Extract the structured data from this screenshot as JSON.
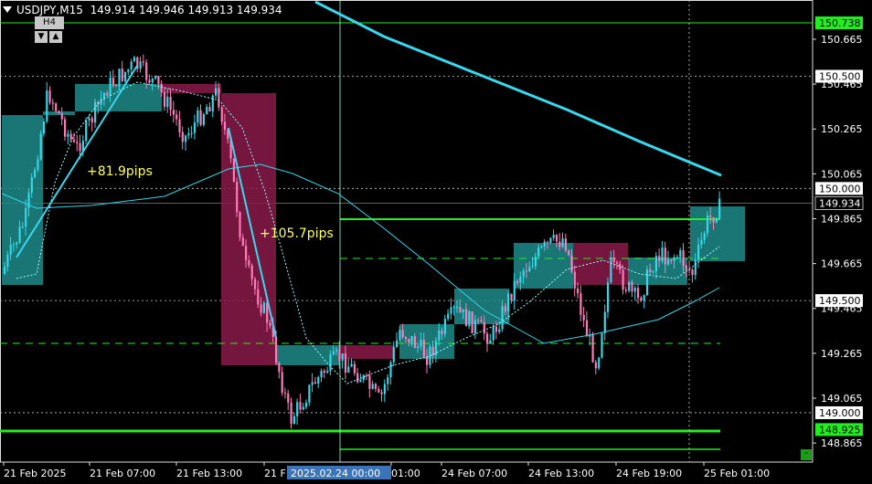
{
  "header": {
    "symbol": "USDJPY,M15",
    "open": "149.914",
    "high": "149.946",
    "low": "149.913",
    "close": "149.934"
  },
  "timeframe_box": {
    "label": "H4",
    "down_icon": "▼",
    "up_icon": "▲"
  },
  "corner_button": "-",
  "colors": {
    "background": "#000000",
    "grid": "#c0c0c0",
    "bull": "#35d6e6",
    "bear": "#ff7ab8",
    "bull_zone": "#1f8a8a",
    "bear_zone": "#8a1a4a",
    "level_green": "#22ee22",
    "ma_slow": "#38d8ee",
    "annotation": "#ffff66"
  },
  "price_axis": {
    "min": 148.78,
    "max": 150.84,
    "ticks": [
      "150.665",
      "150.465",
      "150.265",
      "150.065",
      "149.865",
      "149.665",
      "149.465",
      "149.265",
      "149.065",
      "148.865"
    ],
    "tick_values": [
      150.665,
      150.465,
      150.265,
      150.065,
      149.865,
      149.665,
      149.465,
      149.265,
      149.065,
      148.865
    ],
    "labels": [
      {
        "text": "150.738",
        "value": 150.738,
        "style": "green"
      },
      {
        "text": "150.500",
        "value": 150.5,
        "style": "white"
      },
      {
        "text": "150.000",
        "value": 150.0,
        "style": "white"
      },
      {
        "text": "149.934",
        "value": 149.934,
        "style": "current"
      },
      {
        "text": "149.500",
        "value": 149.5,
        "style": "white"
      },
      {
        "text": "149.000",
        "value": 149.0,
        "style": "white"
      },
      {
        "text": "148.925",
        "value": 148.925,
        "style": "green"
      }
    ]
  },
  "time_axis": {
    "labels": [
      "21 Feb 2025",
      "21 Feb 07:00",
      "21 Feb 13:00",
      "21 F",
      "01:00",
      "24 Feb 07:00",
      "24 Feb 13:00",
      "24 Feb 19:00",
      "25 Feb 01:00"
    ],
    "crosshair_label": "2025.02.24 00:00"
  },
  "annotations": [
    "+81.9pips",
    "+105.7pips"
  ],
  "chart_data": {
    "type": "candlestick",
    "symbol": "USDJPY",
    "timeframe": "M15",
    "ylim": [
      148.78,
      150.84
    ],
    "horizontal_levels": [
      150.738,
      150.5,
      150.0,
      149.934,
      149.5,
      149.0,
      148.925
    ],
    "annotations": [
      "+81.9pips",
      "+105.7pips"
    ]
  }
}
